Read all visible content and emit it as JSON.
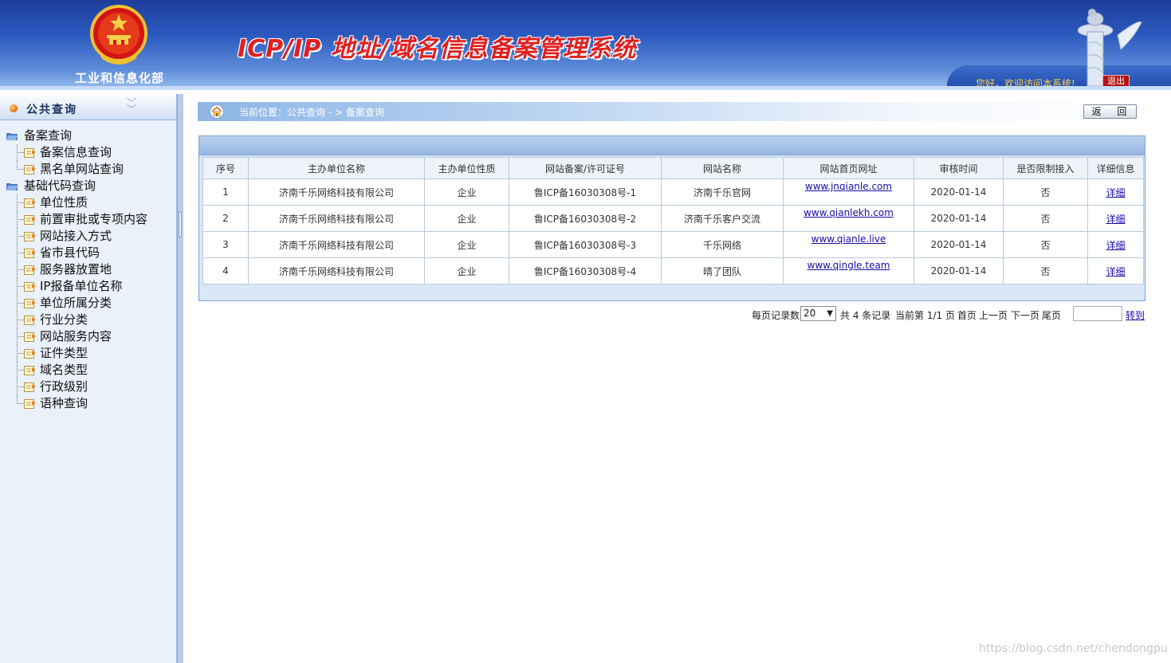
{
  "header": {
    "ministry": "工业和信息化部",
    "system_title": "ICP/IP 地址/域名信息备案管理系统",
    "welcome": "您好，欢迎访问本系统!",
    "logout_label": "退出"
  },
  "sidebar": {
    "title": "公共查询",
    "groups": [
      {
        "label": "备案查询",
        "items": [
          "备案信息查询",
          "黑名单网站查询"
        ]
      },
      {
        "label": "基础代码查询",
        "items": [
          "单位性质",
          "前置审批或专项内容",
          "网站接入方式",
          "省市县代码",
          "服务器放置地",
          "IP报备单位名称",
          "单位所属分类",
          "行业分类",
          "网站服务内容",
          "证件类型",
          "域名类型",
          "行政级别",
          "语种查询"
        ]
      }
    ]
  },
  "breadcrumb": {
    "text": "当前位置：公共查询  - >  备案查询",
    "back_label": "返 回"
  },
  "table": {
    "headers": [
      "序号",
      "主办单位名称",
      "主办单位性质",
      "网站备案/许可证号",
      "网站名称",
      "网站首页网址",
      "审核时间",
      "是否限制接入",
      "详细信息"
    ],
    "rows": [
      {
        "no": "1",
        "org": "济南千乐网络科技有限公司",
        "nature": "企业",
        "license": "鲁ICP备16030308号-1",
        "site": "济南千乐官网",
        "url": "www.jnqianle.com",
        "date": "2020-01-14",
        "restricted": "否",
        "detail": "详细"
      },
      {
        "no": "2",
        "org": "济南千乐网络科技有限公司",
        "nature": "企业",
        "license": "鲁ICP备16030308号-2",
        "site": "济南千乐客户交流",
        "url": "www.qianlekh.com",
        "date": "2020-01-14",
        "restricted": "否",
        "detail": "详细"
      },
      {
        "no": "3",
        "org": "济南千乐网络科技有限公司",
        "nature": "企业",
        "license": "鲁ICP备16030308号-3",
        "site": "千乐网络",
        "url": "www.qianle.live",
        "date": "2020-01-14",
        "restricted": "否",
        "detail": "详细"
      },
      {
        "no": "4",
        "org": "济南千乐网络科技有限公司",
        "nature": "企业",
        "license": "鲁ICP备16030308号-4",
        "site": "晴了团队",
        "url": "www.qingle.team",
        "date": "2020-01-14",
        "restricted": "否",
        "detail": "详细"
      }
    ]
  },
  "pager": {
    "per_page_label": "每页记录数",
    "page_size": "20",
    "total_text": "共 4 条记录",
    "current_text": "当前第 1/1 页",
    "first": "首页",
    "prev": "上一页",
    "next": "下一页",
    "last": "尾页",
    "goto_label": "转到"
  },
  "watermark": "https://blog.csdn.net/chendongpu",
  "icons": {
    "emblem": "national-emblem-icon",
    "huabiao": "huabiao-column-icon",
    "home": "home-icon",
    "folder": "folder-icon",
    "leaf": "document-arrow-icon"
  },
  "colors": {
    "header_blue": "#2b58be",
    "title_red": "#e02020",
    "welcome_gold": "#ffd24a",
    "logout_red": "#b01313",
    "link_blue": "#1a0dab"
  }
}
